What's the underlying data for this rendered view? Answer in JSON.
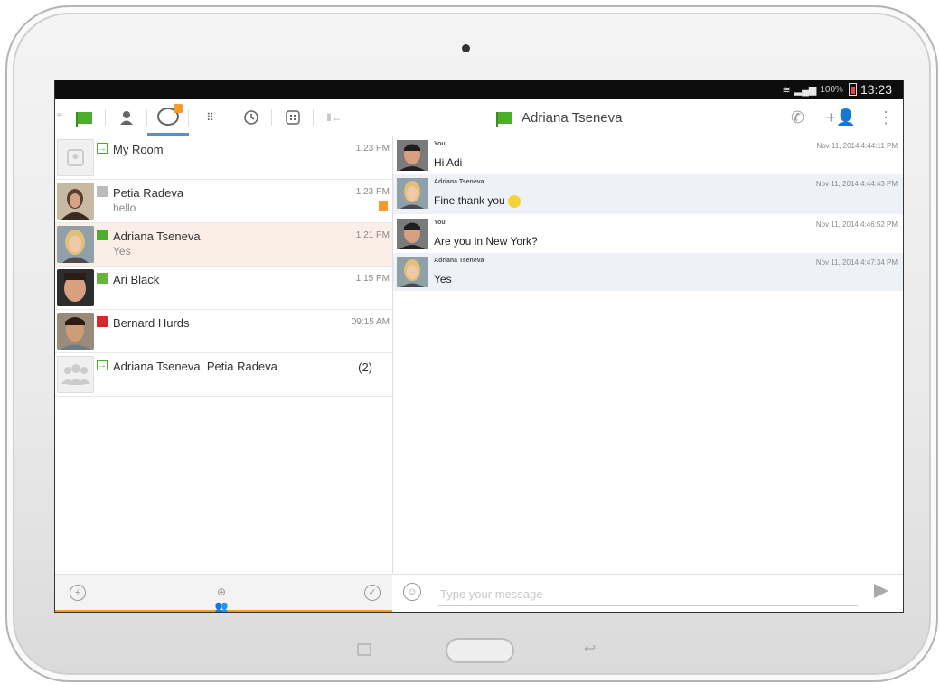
{
  "status_bar": {
    "signal": "100%",
    "time": "13:23"
  },
  "header": {
    "contact_name": "Adriana Tseneva",
    "tabs": [
      {
        "icon": "flag-icon"
      },
      {
        "icon": "contacts-icon"
      },
      {
        "icon": "chat-icon",
        "active": true
      },
      {
        "icon": "dialpad-icon"
      },
      {
        "icon": "history-icon"
      },
      {
        "icon": "directory-icon"
      },
      {
        "icon": "collapse-icon"
      }
    ]
  },
  "conversations": [
    {
      "name": "My Room",
      "sub": "",
      "time": "1:23 PM",
      "marker": "enter"
    },
    {
      "name": "Petia Radeva",
      "sub": "hello",
      "time": "1:23 PM",
      "marker": "gray-flag",
      "unread": true
    },
    {
      "name": "Adriana Tseneva",
      "sub": "Yes",
      "time": "1:21 PM",
      "marker": "green-flag",
      "selected": true
    },
    {
      "name": "Ari Black",
      "sub": "",
      "time": "1:15 PM",
      "marker": "green-box"
    },
    {
      "name": "Bernard Hurds",
      "sub": "",
      "time": "09:15 AM",
      "marker": "red-flag"
    },
    {
      "name": "Adriana Tseneva, Petia Radeva",
      "sub": "",
      "time": "",
      "count": "(2)",
      "marker": "enter"
    }
  ],
  "messages": [
    {
      "sender": "You",
      "text": "Hi Adi",
      "time": "Nov 11, 2014 4:44:11 PM",
      "emoji": false
    },
    {
      "sender": "Adriana Tseneva",
      "text": "Fine thank you",
      "time": "Nov 11, 2014 4:44:43 PM",
      "emoji": true
    },
    {
      "sender": "You",
      "text": "Are you in New York?",
      "time": "Nov 11, 2014 4:46:52 PM",
      "emoji": false
    },
    {
      "sender": "Adriana Tseneva",
      "text": "Yes",
      "time": "Nov 11, 2014 4:47:34 PM",
      "emoji": false
    }
  ],
  "composer": {
    "placeholder": "Type your message"
  }
}
